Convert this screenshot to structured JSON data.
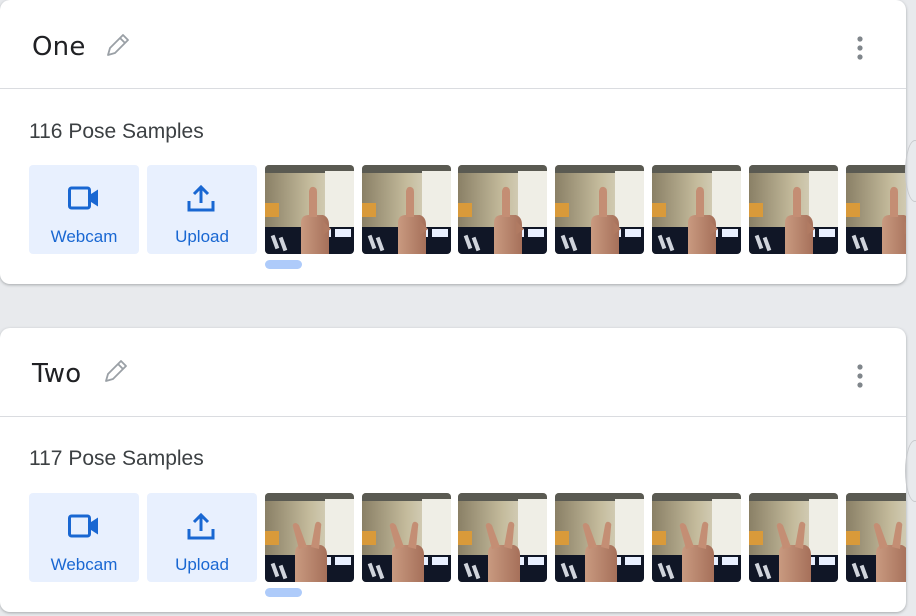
{
  "classes": [
    {
      "name": "One",
      "samples_label": "116 Pose Samples",
      "webcam_label": "Webcam",
      "upload_label": "Upload",
      "gesture": "one-finger",
      "thumbnail_count": 7
    },
    {
      "name": "Two",
      "samples_label": "117 Pose Samples",
      "webcam_label": "Webcam",
      "upload_label": "Upload",
      "gesture": "peace-sign",
      "thumbnail_count": 7
    }
  ],
  "icons": {
    "edit": "pencil-icon",
    "more": "more-vert-icon",
    "webcam": "videocam-icon",
    "upload": "upload-icon"
  },
  "colors": {
    "accent": "#1967d2",
    "button_bg": "#e8f0fe",
    "scroll_indicator": "#aecbfa",
    "page_bg": "#e8eaed"
  }
}
